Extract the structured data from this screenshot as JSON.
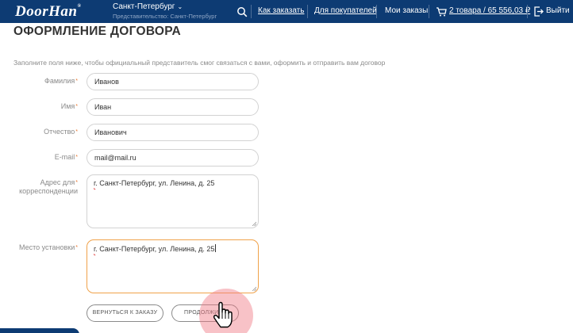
{
  "header": {
    "logo": "DoorHan",
    "logo_mark": "®",
    "city": "Санкт-Петербург",
    "representative": "Представительство: Санкт-Петербург",
    "nav_how_to_order": "Как заказать",
    "nav_for_buyers": "Для покупателей",
    "nav_my_orders": "Мои заказы",
    "cart": "2 товара / 65 556,03 ₽",
    "logout": "Выйти"
  },
  "page": {
    "title": "ОФОРМЛЕНИЕ ДОГОВОРА",
    "intro": "Заполните поля ниже, чтобы официальный представитель смог связаться с вами, оформить и отправить вам договор"
  },
  "form": {
    "required_mark": "*",
    "last_name_label": "Фамилия",
    "last_name_value": "Иванов",
    "first_name_label": "Имя",
    "first_name_value": "Иван",
    "middle_name_label": "Отчество",
    "middle_name_value": "Иванович",
    "email_label": "E-mail",
    "email_value": "mail@mail.ru",
    "address_label_1": "Адрес для",
    "address_label_2": "корреспонденции",
    "address_value": {
      "p1": "г",
      "p2": ". Санкт-Петербург, ул. Ленина, ",
      "p3": "д",
      "p4": ". 25"
    },
    "install_label": "Место установки",
    "install_value": {
      "p1": "г",
      "p2": ". Санкт-Петербург, ул. Ленина, ",
      "p3": "д",
      "p4": ". 25"
    }
  },
  "buttons": {
    "back": "ВЕРНУТЬСЯ К ЗАКАЗУ",
    "continue": "ПРОДОЛЖИТЬ"
  },
  "colors": {
    "header_bg": "#0d3b73",
    "required": "#e8762e",
    "focus_border": "#f0a24a",
    "click_pulse": "#f07882"
  },
  "icons": [
    "search-icon",
    "cart-icon",
    "logout-icon",
    "chevron-down-icon",
    "pointer-hand-icon",
    "resize-grip-icon"
  ]
}
